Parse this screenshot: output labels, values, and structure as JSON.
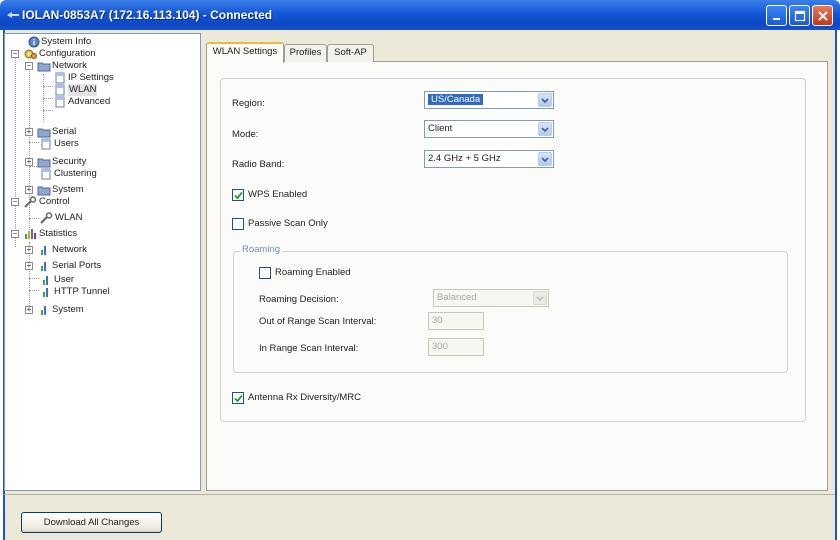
{
  "window": {
    "title": "IOLAN-0853A7 (172.16.113.104) - Connected"
  },
  "tree": [
    {
      "label": "System Info"
    },
    {
      "label": "Configuration"
    },
    {
      "label": "Network"
    },
    {
      "label": "IP Settings"
    },
    {
      "label": "WLAN"
    },
    {
      "label": "Advanced"
    },
    {
      "label": "Serial"
    },
    {
      "label": "Users"
    },
    {
      "label": "Security"
    },
    {
      "label": "Clustering"
    },
    {
      "label": "System"
    },
    {
      "label": "Control"
    },
    {
      "label": "WLAN"
    },
    {
      "label": "Statistics"
    },
    {
      "label": "Network"
    },
    {
      "label": "Serial Ports"
    },
    {
      "label": "User"
    },
    {
      "label": "HTTP Tunnel"
    },
    {
      "label": "System"
    }
  ],
  "tabs": [
    {
      "label": "WLAN Settings"
    },
    {
      "label": "Profiles"
    },
    {
      "label": "Soft-AP"
    }
  ],
  "form": {
    "region_label": "Region:",
    "region_value": "US/Canada",
    "mode_label": "Mode:",
    "mode_value": "Client",
    "radio_band_label": "Radio Band:",
    "radio_band_value": "2.4 GHz + 5 GHz",
    "wps_label": "WPS Enabled",
    "wps_checked": true,
    "passive_scan_label": "Passive Scan Only",
    "passive_scan_checked": false,
    "roaming_legend": "Roaming",
    "roaming_enabled_label": "Roaming Enabled",
    "roaming_enabled_checked": false,
    "roaming_decision_label": "Roaming Decision:",
    "roaming_decision_value": "Balanced",
    "out_of_range_label": "Out of Range Scan Interval:",
    "out_of_range_value": "30",
    "in_range_label": "In Range Scan Interval:",
    "in_range_value": "300",
    "antenna_label": "Antenna Rx Diversity/MRC",
    "antenna_checked": true
  },
  "bottom": {
    "download_button": "Download All Changes"
  },
  "colors": {
    "titlebar": "#1556d6",
    "selection": "#316ac5",
    "tab_accent": "#f5b544"
  },
  "icons": {
    "system_info": "info-icon",
    "configuration": "config-gear-icon",
    "folder": "folder-icon",
    "page": "page-icon",
    "control": "wrench-icon",
    "statistics": "bar-chart-icon"
  }
}
